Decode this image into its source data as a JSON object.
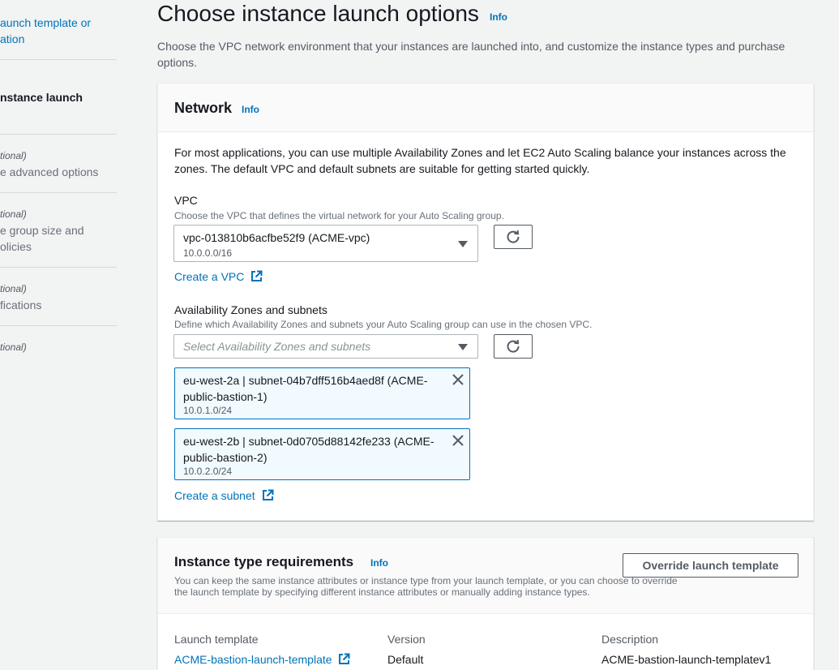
{
  "sidebar": {
    "step1_link_line1": "aunch template or",
    "step1_link_line2": "ation",
    "step2_current": "nstance launch",
    "step3_optional": "tional)",
    "step3_label": "e advanced options",
    "step4_optional": "tional)",
    "step4_label_line1": "e group size and",
    "step4_label_line2": "olicies",
    "step5_optional": "tional)",
    "step5_label": "fications",
    "step6_optional": "tional)"
  },
  "header": {
    "title": "Choose instance launch options",
    "info": "Info",
    "description": "Choose the VPC network environment that your instances are launched into, and customize the instance types and purchase options."
  },
  "network": {
    "title": "Network",
    "info": "Info",
    "intro": "For most applications, you can use multiple Availability Zones and let EC2 Auto Scaling balance your instances across the zones. The default VPC and default subnets are suitable for getting started quickly.",
    "vpc_label": "VPC",
    "vpc_hint": "Choose the VPC that defines the virtual network for your Auto Scaling group.",
    "vpc_selected": "vpc-013810b6acfbe52f9 (ACME-vpc)",
    "vpc_cidr": "10.0.0.0/16",
    "create_vpc": "Create a VPC",
    "az_label": "Availability Zones and subnets",
    "az_hint": "Define which Availability Zones and subnets your Auto Scaling group can use in the chosen VPC.",
    "az_placeholder": "Select Availability Zones and subnets",
    "subnets": [
      {
        "name": "eu-west-2a | subnet-04b7dff516b4aed8f (ACME-public-bastion-1)",
        "cidr": "10.0.1.0/24"
      },
      {
        "name": "eu-west-2b | subnet-0d0705d88142fe233 (ACME-public-bastion-2)",
        "cidr": "10.0.2.0/24"
      }
    ],
    "create_subnet": "Create a subnet"
  },
  "instance_type": {
    "title": "Instance type requirements",
    "info": "Info",
    "description": "You can keep the same instance attributes or instance type from your launch template, or you can choose to override the launch template by specifying different instance attributes or manually adding instance types.",
    "override_button": "Override launch template",
    "col_launch_template": "Launch template",
    "col_version": "Version",
    "col_description": "Description",
    "launch_template_value": "ACME-bastion-launch-template",
    "version_value": "Default",
    "description_value": "ACME-bastion-launch-templatev1"
  },
  "colors": {
    "link": "#0073bb",
    "token_bg": "#f1faff",
    "text": "#16191f"
  }
}
